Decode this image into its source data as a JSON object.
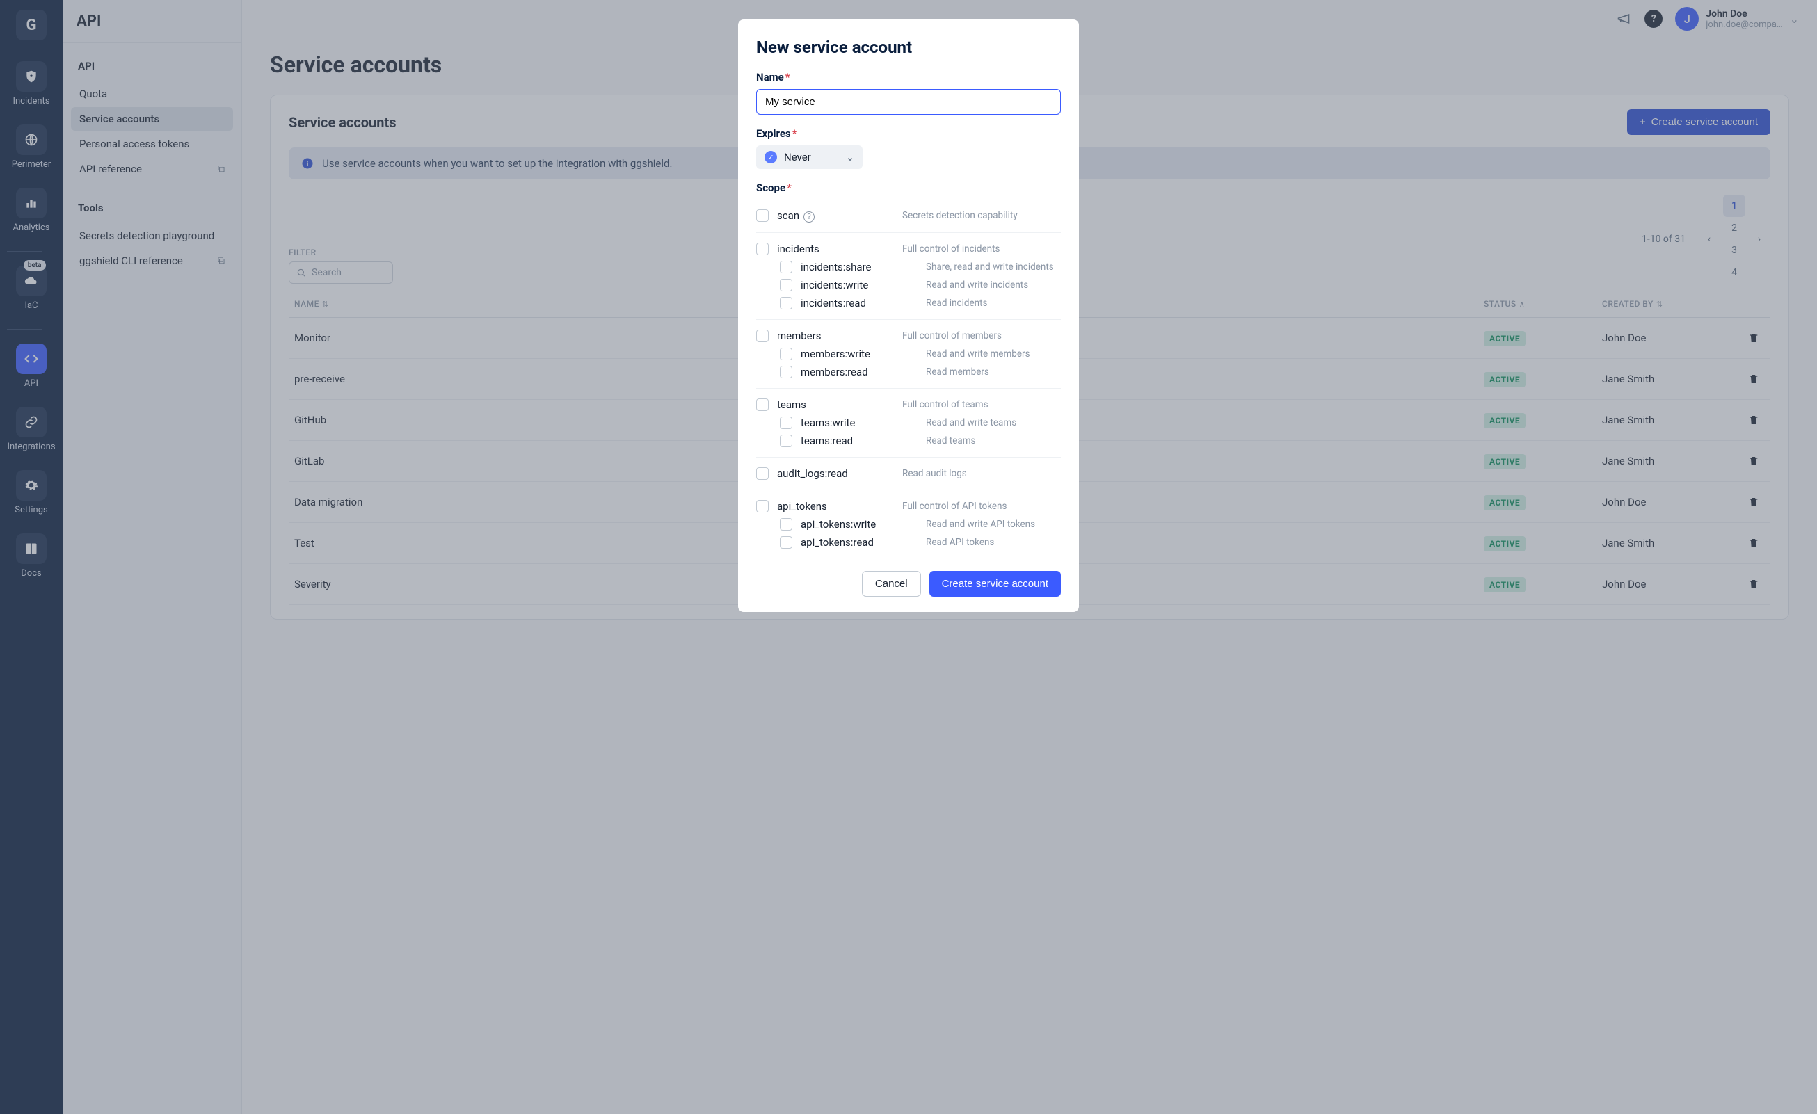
{
  "rail": {
    "logo": "G",
    "items": [
      {
        "label": "Incidents",
        "icon": "shield"
      },
      {
        "label": "Perimeter",
        "icon": "globe"
      },
      {
        "label": "Analytics",
        "icon": "chart"
      },
      {
        "label": "IaC",
        "icon": "cloud",
        "badge": "beta"
      },
      {
        "label": "API",
        "icon": "code",
        "active": true
      },
      {
        "label": "Integrations",
        "icon": "link"
      },
      {
        "label": "Settings",
        "icon": "gear"
      },
      {
        "label": "Docs",
        "icon": "book"
      }
    ]
  },
  "sidebar": {
    "title": "API",
    "section1": "API",
    "links1": [
      {
        "label": "Quota"
      },
      {
        "label": "Service accounts",
        "active": true
      },
      {
        "label": "Personal access tokens"
      },
      {
        "label": "API reference",
        "external": true
      }
    ],
    "section2": "Tools",
    "links2": [
      {
        "label": "Secrets detection playground"
      },
      {
        "label": "ggshield CLI reference",
        "external": true
      }
    ]
  },
  "topbar": {
    "user_name": "John Doe",
    "user_email": "john.doe@compa…",
    "avatar_initial": "J"
  },
  "page": {
    "title": "Service accounts",
    "panel_title": "Service accounts",
    "create_btn": "Create service account",
    "banner": "Use service accounts when you want to set up the integration with ggshield.",
    "filter_label": "FILTER",
    "search_placeholder": "Search",
    "pager_text": "1-10 of 31",
    "pages": [
      "1",
      "2",
      "3",
      "4"
    ],
    "columns": {
      "name": "NAME",
      "status": "STATUS",
      "created_by": "CREATED BY"
    },
    "rows": [
      {
        "name": "Monitor",
        "status": "ACTIVE",
        "by": "John Doe"
      },
      {
        "name": "pre-receive",
        "status": "ACTIVE",
        "by": "Jane Smith"
      },
      {
        "name": "GitHub",
        "status": "ACTIVE",
        "by": "Jane Smith"
      },
      {
        "name": "GitLab",
        "status": "ACTIVE",
        "by": "Jane Smith"
      },
      {
        "name": "Data migration",
        "status": "ACTIVE",
        "by": "John Doe"
      },
      {
        "name": "Test",
        "status": "ACTIVE",
        "by": "Jane Smith"
      },
      {
        "name": "Severity",
        "status": "ACTIVE",
        "by": "John Doe"
      }
    ]
  },
  "modal": {
    "title": "New service account",
    "name_label": "Name",
    "name_value": "My service",
    "expires_label": "Expires",
    "expires_value": "Never",
    "scope_label": "Scope",
    "cancel": "Cancel",
    "submit": "Create service account",
    "scopes": [
      {
        "name": "scan",
        "desc": "Secrets detection capability",
        "help": true
      },
      {
        "name": "incidents",
        "desc": "Full control of incidents",
        "children": [
          {
            "name": "incidents:share",
            "desc": "Share, read and write incidents"
          },
          {
            "name": "incidents:write",
            "desc": "Read and write incidents"
          },
          {
            "name": "incidents:read",
            "desc": "Read incidents"
          }
        ]
      },
      {
        "name": "members",
        "desc": "Full control of members",
        "children": [
          {
            "name": "members:write",
            "desc": "Read and write members"
          },
          {
            "name": "members:read",
            "desc": "Read members"
          }
        ]
      },
      {
        "name": "teams",
        "desc": "Full control of teams",
        "children": [
          {
            "name": "teams:write",
            "desc": "Read and write teams"
          },
          {
            "name": "teams:read",
            "desc": "Read teams"
          }
        ]
      },
      {
        "name": "audit_logs:read",
        "desc": "Read audit logs"
      },
      {
        "name": "api_tokens",
        "desc": "Full control of API tokens",
        "children": [
          {
            "name": "api_tokens:write",
            "desc": "Read and write API tokens"
          },
          {
            "name": "api_tokens:read",
            "desc": "Read API tokens"
          }
        ]
      }
    ]
  }
}
